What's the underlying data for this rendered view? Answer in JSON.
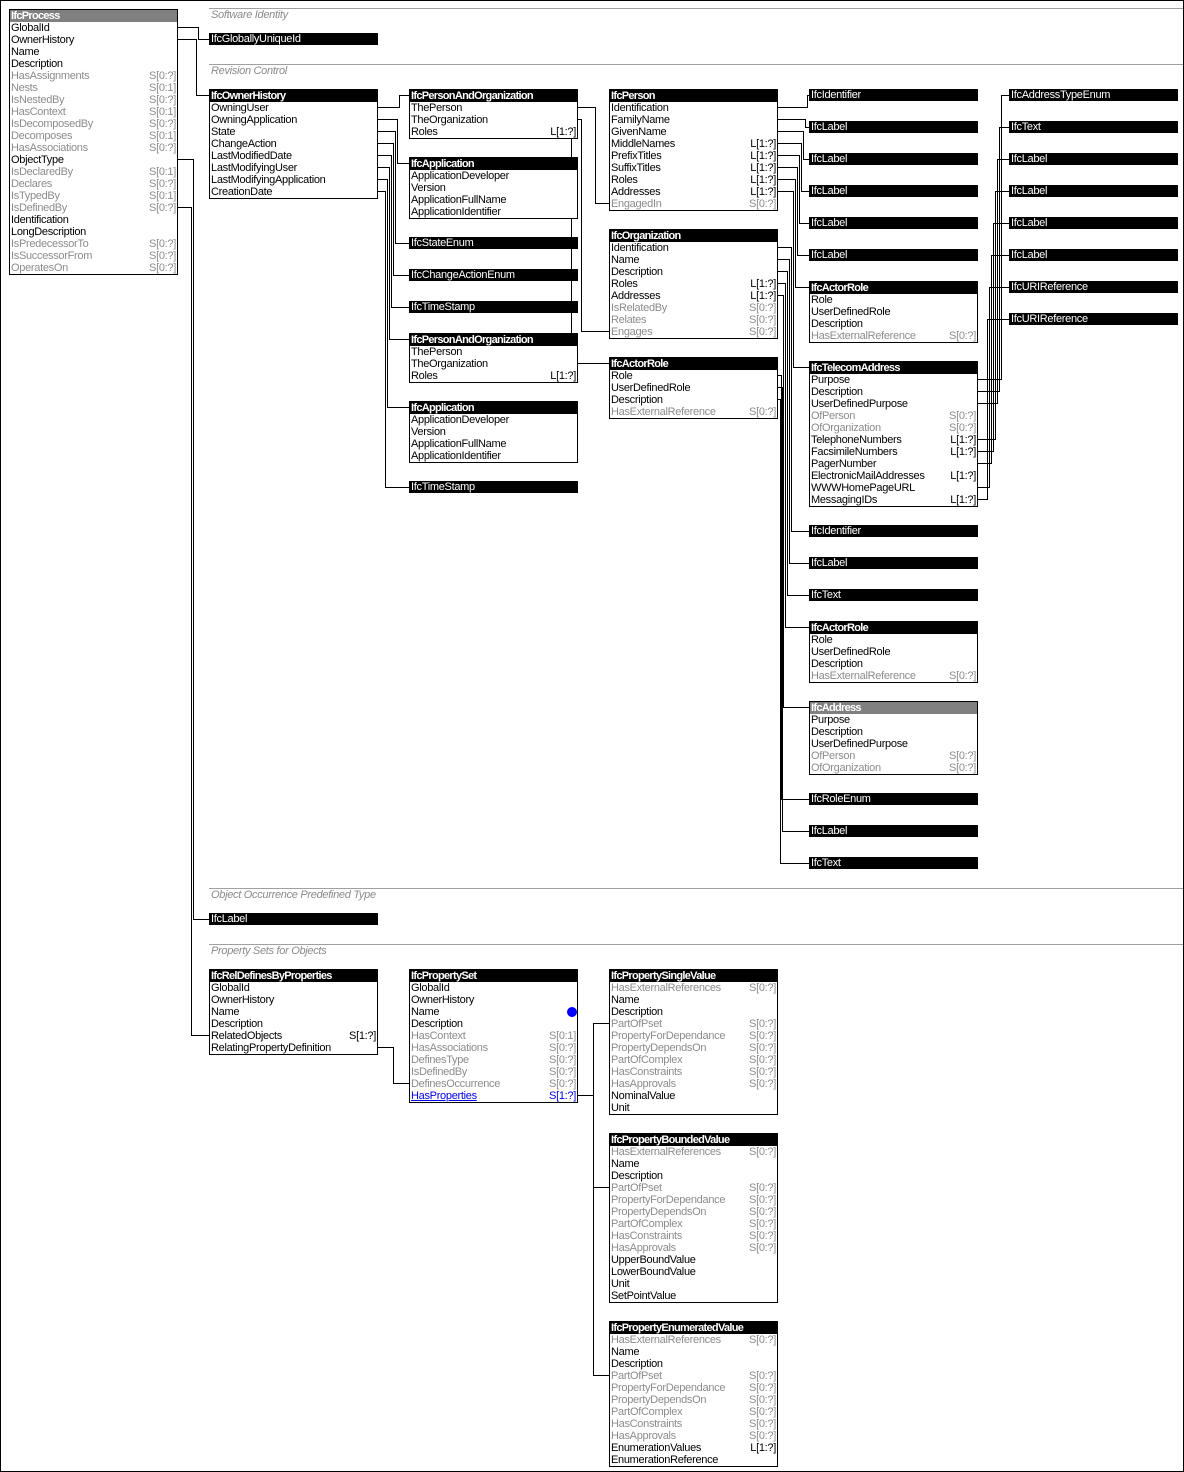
{
  "colors": {
    "header": "#000000",
    "header_grey": "#808080",
    "inverse_text": "#8c8c8c",
    "link": "#0000ee",
    "marker": "#0000ff",
    "section": "#8a8a8a"
  },
  "sections": [
    "Software Identity",
    "Revision Control",
    "Object Occurrence Predefined Type",
    "Property Sets for Objects"
  ],
  "entities": [
    {
      "title": "IfcProcess",
      "header": "grey",
      "attrs": [
        {
          "name": "GlobalId"
        },
        {
          "name": "OwnerHistory"
        },
        {
          "name": "Name"
        },
        {
          "name": "Description"
        },
        {
          "name": "HasAssignments",
          "card": "S[0:?]",
          "style": "inv"
        },
        {
          "name": "Nests",
          "card": "S[0:1]",
          "style": "inv"
        },
        {
          "name": "IsNestedBy",
          "card": "S[0:?]",
          "style": "inv"
        },
        {
          "name": "HasContext",
          "card": "S[0:1]",
          "style": "inv"
        },
        {
          "name": "IsDecomposedBy",
          "card": "S[0:?]",
          "style": "inv"
        },
        {
          "name": "Decomposes",
          "card": "S[0:1]",
          "style": "inv"
        },
        {
          "name": "HasAssociations",
          "card": "S[0:?]",
          "style": "inv"
        },
        {
          "name": "ObjectType"
        },
        {
          "name": "IsDeclaredBy",
          "card": "S[0:1]",
          "style": "inv"
        },
        {
          "name": "Declares",
          "card": "S[0:?]",
          "style": "inv"
        },
        {
          "name": "IsTypedBy",
          "card": "S[0:1]",
          "style": "inv"
        },
        {
          "name": "IsDefinedBy",
          "card": "S[0:?]",
          "style": "inv"
        },
        {
          "name": "Identification"
        },
        {
          "name": "LongDescription"
        },
        {
          "name": "IsPredecessorTo",
          "card": "S[0:?]",
          "style": "inv"
        },
        {
          "name": "IsSuccessorFrom",
          "card": "S[0:?]",
          "style": "inv"
        },
        {
          "name": "OperatesOn",
          "card": "S[0:?]",
          "style": "inv"
        }
      ]
    },
    {
      "title": "IfcGloballyUniqueId",
      "bar": true
    },
    {
      "title": "IfcOwnerHistory",
      "attrs": [
        {
          "name": "OwningUser"
        },
        {
          "name": "OwningApplication"
        },
        {
          "name": "State"
        },
        {
          "name": "ChangeAction"
        },
        {
          "name": "LastModifiedDate"
        },
        {
          "name": "LastModifyingUser"
        },
        {
          "name": "LastModifyingApplication"
        },
        {
          "name": "CreationDate"
        }
      ]
    },
    {
      "title": "IfcPersonAndOrganization",
      "attrs": [
        {
          "name": "ThePerson"
        },
        {
          "name": "TheOrganization"
        },
        {
          "name": "Roles",
          "card": "L[1:?]"
        }
      ]
    },
    {
      "title": "IfcApplication",
      "attrs": [
        {
          "name": "ApplicationDeveloper"
        },
        {
          "name": "Version"
        },
        {
          "name": "ApplicationFullName"
        },
        {
          "name": "ApplicationIdentifier"
        }
      ]
    },
    {
      "title": "IfcStateEnum",
      "bar": true
    },
    {
      "title": "IfcChangeActionEnum",
      "bar": true
    },
    {
      "title": "IfcTimeStamp",
      "bar": true
    },
    {
      "title": "IfcPersonAndOrganization",
      "attrs": [
        {
          "name": "ThePerson"
        },
        {
          "name": "TheOrganization"
        },
        {
          "name": "Roles",
          "card": "L[1:?]"
        }
      ]
    },
    {
      "title": "IfcApplication",
      "attrs": [
        {
          "name": "ApplicationDeveloper"
        },
        {
          "name": "Version"
        },
        {
          "name": "ApplicationFullName"
        },
        {
          "name": "ApplicationIdentifier"
        }
      ]
    },
    {
      "title": "IfcTimeStamp",
      "bar": true
    },
    {
      "title": "IfcPerson",
      "attrs": [
        {
          "name": "Identification"
        },
        {
          "name": "FamilyName"
        },
        {
          "name": "GivenName"
        },
        {
          "name": "MiddleNames",
          "card": "L[1:?]"
        },
        {
          "name": "PrefixTitles",
          "card": "L[1:?]"
        },
        {
          "name": "SuffixTitles",
          "card": "L[1:?]"
        },
        {
          "name": "Roles",
          "card": "L[1:?]"
        },
        {
          "name": "Addresses",
          "card": "L[1:?]"
        },
        {
          "name": "EngagedIn",
          "card": "S[0:?]",
          "style": "inv"
        }
      ]
    },
    {
      "title": "IfcOrganization",
      "attrs": [
        {
          "name": "Identification"
        },
        {
          "name": "Name"
        },
        {
          "name": "Description"
        },
        {
          "name": "Roles",
          "card": "L[1:?]"
        },
        {
          "name": "Addresses",
          "card": "L[1:?]"
        },
        {
          "name": "IsRelatedBy",
          "card": "S[0:?]",
          "style": "inv"
        },
        {
          "name": "Relates",
          "card": "S[0:?]",
          "style": "inv"
        },
        {
          "name": "Engages",
          "card": "S[0:?]",
          "style": "inv"
        }
      ]
    },
    {
      "title": "IfcActorRole",
      "attrs": [
        {
          "name": "Role"
        },
        {
          "name": "UserDefinedRole"
        },
        {
          "name": "Description"
        },
        {
          "name": "HasExternalReference",
          "card": "S[0:?]",
          "style": "inv"
        }
      ]
    },
    {
      "title": "IfcIdentifier",
      "bar": true
    },
    {
      "title": "IfcLabel",
      "bar": true
    },
    {
      "title": "IfcLabel",
      "bar": true
    },
    {
      "title": "IfcLabel",
      "bar": true
    },
    {
      "title": "IfcLabel",
      "bar": true
    },
    {
      "title": "IfcLabel",
      "bar": true
    },
    {
      "title": "IfcActorRole",
      "attrs": [
        {
          "name": "Role"
        },
        {
          "name": "UserDefinedRole"
        },
        {
          "name": "Description"
        },
        {
          "name": "HasExternalReference",
          "card": "S[0:?]",
          "style": "inv"
        }
      ]
    },
    {
      "title": "IfcTelecomAddress",
      "attrs": [
        {
          "name": "Purpose"
        },
        {
          "name": "Description"
        },
        {
          "name": "UserDefinedPurpose"
        },
        {
          "name": "OfPerson",
          "card": "S[0:?]",
          "style": "inv"
        },
        {
          "name": "OfOrganization",
          "card": "S[0:?]",
          "style": "inv"
        },
        {
          "name": "TelephoneNumbers",
          "card": "L[1:?]"
        },
        {
          "name": "FacsimileNumbers",
          "card": "L[1:?]"
        },
        {
          "name": "PagerNumber"
        },
        {
          "name": "ElectronicMailAddresses",
          "card": "L[1:?]"
        },
        {
          "name": "WWWHomePageURL"
        },
        {
          "name": "MessagingIDs",
          "card": "L[1:?]"
        }
      ]
    },
    {
      "title": "IfcIdentifier",
      "bar": true
    },
    {
      "title": "IfcLabel",
      "bar": true
    },
    {
      "title": "IfcText",
      "bar": true
    },
    {
      "title": "IfcActorRole",
      "attrs": [
        {
          "name": "Role"
        },
        {
          "name": "UserDefinedRole"
        },
        {
          "name": "Description"
        },
        {
          "name": "HasExternalReference",
          "card": "S[0:?]",
          "style": "inv"
        }
      ]
    },
    {
      "title": "IfcAddress",
      "header": "grey",
      "attrs": [
        {
          "name": "Purpose"
        },
        {
          "name": "Description"
        },
        {
          "name": "UserDefinedPurpose"
        },
        {
          "name": "OfPerson",
          "card": "S[0:?]",
          "style": "inv"
        },
        {
          "name": "OfOrganization",
          "card": "S[0:?]",
          "style": "inv"
        }
      ]
    },
    {
      "title": "IfcRoleEnum",
      "bar": true
    },
    {
      "title": "IfcLabel",
      "bar": true
    },
    {
      "title": "IfcText",
      "bar": true
    },
    {
      "title": "IfcAddressTypeEnum",
      "bar": true
    },
    {
      "title": "IfcText",
      "bar": true
    },
    {
      "title": "IfcLabel",
      "bar": true
    },
    {
      "title": "IfcLabel",
      "bar": true
    },
    {
      "title": "IfcLabel",
      "bar": true
    },
    {
      "title": "IfcLabel",
      "bar": true
    },
    {
      "title": "IfcURIReference",
      "bar": true
    },
    {
      "title": "IfcURIReference",
      "bar": true
    },
    {
      "title": "IfcLabel",
      "bar": true
    },
    {
      "title": "IfcRelDefinesByProperties",
      "attrs": [
        {
          "name": "GlobalId"
        },
        {
          "name": "OwnerHistory"
        },
        {
          "name": "Name"
        },
        {
          "name": "Description"
        },
        {
          "name": "RelatedObjects",
          "card": "S[1:?]"
        },
        {
          "name": "RelatingPropertyDefinition"
        }
      ]
    },
    {
      "title": "IfcPropertySet",
      "attrs": [
        {
          "name": "GlobalId"
        },
        {
          "name": "OwnerHistory"
        },
        {
          "name": "Name",
          "marker": true
        },
        {
          "name": "Description"
        },
        {
          "name": "HasContext",
          "card": "S[0:1]",
          "style": "inv"
        },
        {
          "name": "HasAssociations",
          "card": "S[0:?]",
          "style": "inv"
        },
        {
          "name": "DefinesType",
          "card": "S[0:?]",
          "style": "inv"
        },
        {
          "name": "IsDefinedBy",
          "card": "S[0:?]",
          "style": "inv"
        },
        {
          "name": "DefinesOccurrence",
          "card": "S[0:?]",
          "style": "inv"
        },
        {
          "name": "HasProperties",
          "card": "S[1:?]",
          "style": "link"
        }
      ]
    },
    {
      "title": "IfcPropertySingleValue",
      "attrs": [
        {
          "name": "HasExternalReferences",
          "card": "S[0:?]",
          "style": "inv"
        },
        {
          "name": "Name"
        },
        {
          "name": "Description"
        },
        {
          "name": "PartOfPset",
          "card": "S[0:?]",
          "style": "inv"
        },
        {
          "name": "PropertyForDependance",
          "card": "S[0:?]",
          "style": "inv"
        },
        {
          "name": "PropertyDependsOn",
          "card": "S[0:?]",
          "style": "inv"
        },
        {
          "name": "PartOfComplex",
          "card": "S[0:?]",
          "style": "inv"
        },
        {
          "name": "HasConstraints",
          "card": "S[0:?]",
          "style": "inv"
        },
        {
          "name": "HasApprovals",
          "card": "S[0:?]",
          "style": "inv"
        },
        {
          "name": "NominalValue"
        },
        {
          "name": "Unit"
        }
      ]
    },
    {
      "title": "IfcPropertyBoundedValue",
      "attrs": [
        {
          "name": "HasExternalReferences",
          "card": "S[0:?]",
          "style": "inv"
        },
        {
          "name": "Name"
        },
        {
          "name": "Description"
        },
        {
          "name": "PartOfPset",
          "card": "S[0:?]",
          "style": "inv"
        },
        {
          "name": "PropertyForDependance",
          "card": "S[0:?]",
          "style": "inv"
        },
        {
          "name": "PropertyDependsOn",
          "card": "S[0:?]",
          "style": "inv"
        },
        {
          "name": "PartOfComplex",
          "card": "S[0:?]",
          "style": "inv"
        },
        {
          "name": "HasConstraints",
          "card": "S[0:?]",
          "style": "inv"
        },
        {
          "name": "HasApprovals",
          "card": "S[0:?]",
          "style": "inv"
        },
        {
          "name": "UpperBoundValue"
        },
        {
          "name": "LowerBoundValue"
        },
        {
          "name": "Unit"
        },
        {
          "name": "SetPointValue"
        }
      ]
    },
    {
      "title": "IfcPropertyEnumeratedValue",
      "attrs": [
        {
          "name": "HasExternalReferences",
          "card": "S[0:?]",
          "style": "inv"
        },
        {
          "name": "Name"
        },
        {
          "name": "Description"
        },
        {
          "name": "PartOfPset",
          "card": "S[0:?]",
          "style": "inv"
        },
        {
          "name": "PropertyForDependance",
          "card": "S[0:?]",
          "style": "inv"
        },
        {
          "name": "PropertyDependsOn",
          "card": "S[0:?]",
          "style": "inv"
        },
        {
          "name": "PartOfComplex",
          "card": "S[0:?]",
          "style": "inv"
        },
        {
          "name": "HasConstraints",
          "card": "S[0:?]",
          "style": "inv"
        },
        {
          "name": "HasApprovals",
          "card": "S[0:?]",
          "style": "inv"
        },
        {
          "name": "EnumerationValues",
          "card": "L[1:?]"
        },
        {
          "name": "EnumerationReference"
        }
      ]
    }
  ]
}
